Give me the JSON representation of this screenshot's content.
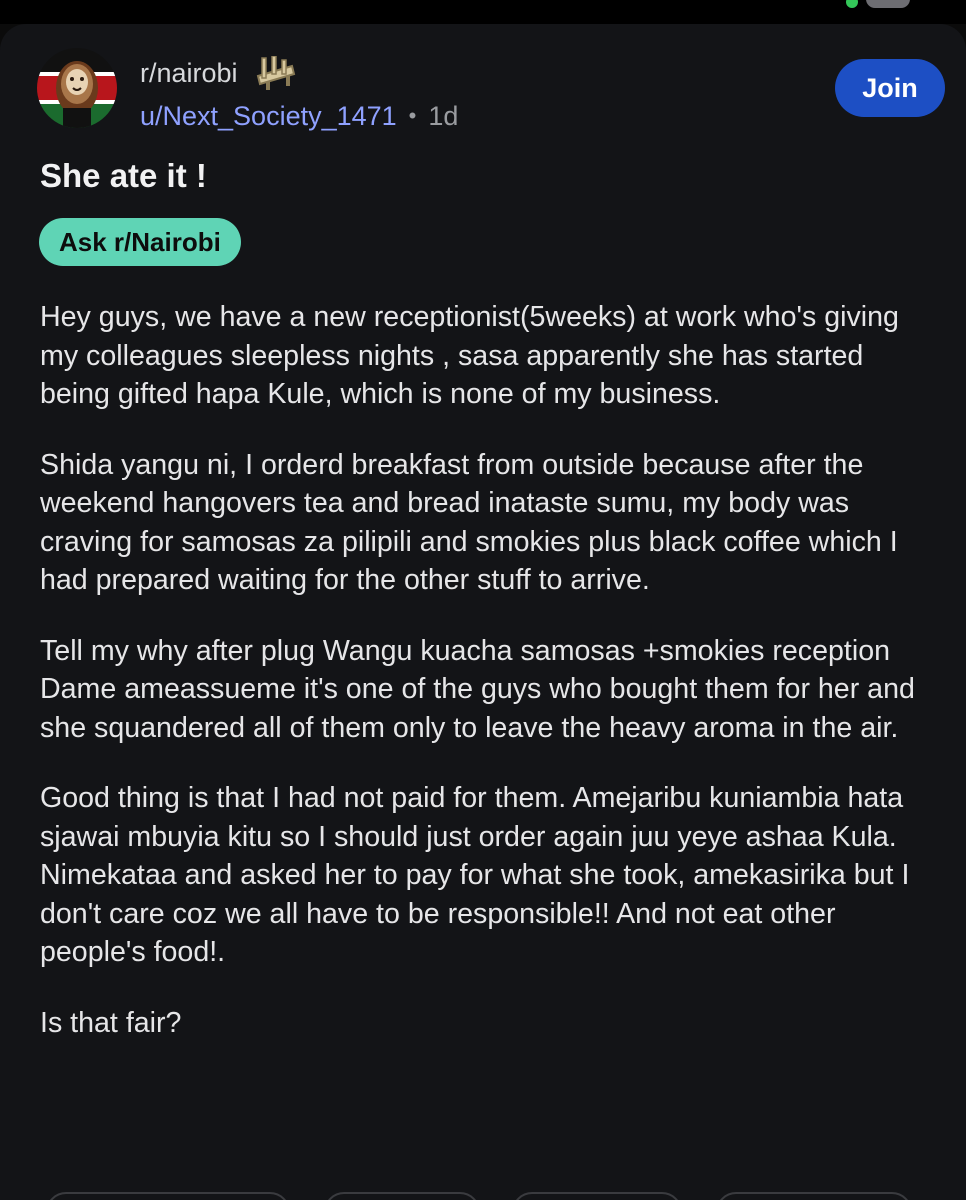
{
  "post": {
    "subreddit": "r/nairobi",
    "author": "u/Next_Society_1471",
    "separator": "•",
    "age": "1d",
    "join_label": "Join",
    "title": "She ate it !",
    "flair": "Ask r/Nairobi",
    "paragraphs": [
      "Hey guys, we have a new receptionist(5weeks) at work who's giving my colleagues sleepless nights , sasa apparently she has started being gifted hapa Kule, which is none of my business.",
      "Shida yangu ni, I orderd breakfast from outside because after the weekend hangovers tea and bread inataste sumu, my body was craving for samosas za pilipili  and smokies plus black coffee which I had prepared waiting for the other stuff to arrive.",
      "Tell my why after plug Wangu kuacha samosas +smokies reception Dame ameassueme it's one of the guys who bought them for her and she squandered all of them only to leave the heavy aroma in the air.",
      "Good thing is that I had not paid for them. Amejaribu kuniambia hata sjawai mbuyia kitu so I should just order again juu yeye ashaa Kula. Nimekataa and asked her to pay for what she took, amekasirika but I don't care coz we all have to be responsible!! And not eat other people's  food!.",
      "Is that fair?"
    ]
  },
  "icons": {
    "avatar": "kenya-flag-lion-avatar",
    "award": "award-trophy-icon"
  },
  "colors": {
    "background": "#131417",
    "username": "#8fa1ff",
    "join_button": "#1d4fc4",
    "flair": "#5fd4b5"
  }
}
